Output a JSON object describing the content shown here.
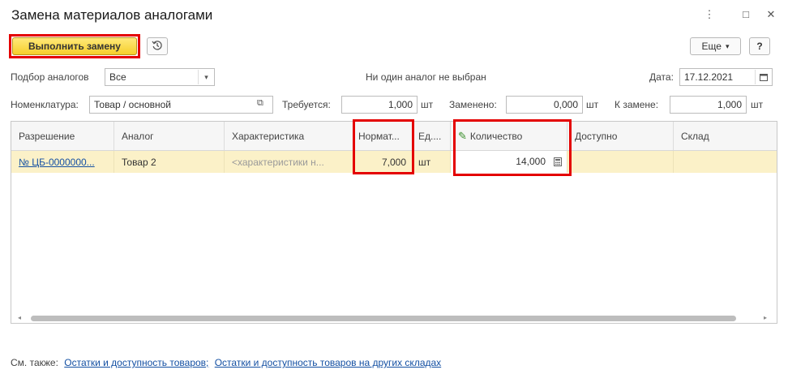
{
  "window": {
    "title": "Замена материалов аналогами",
    "menu_icon": "⋮",
    "maximize_icon": "□",
    "close_icon": "✕"
  },
  "toolbar": {
    "execute_label": "Выполнить замену",
    "history_icon": "history-icon",
    "more_label": "Еще",
    "more_arrow": "▾",
    "help_label": "?"
  },
  "filters": {
    "analog_selection_label": "Подбор аналогов",
    "analog_selection_value": "Все",
    "status_text": "Ни один аналог не выбран",
    "date_label": "Дата:",
    "date_value": "17.12.2021"
  },
  "summary": {
    "nomenclature_label": "Номенклатура:",
    "nomenclature_value": "Товар / основной",
    "required_label": "Требуется:",
    "required_value": "1,000",
    "required_unit": "шт",
    "replaced_label": "Заменено:",
    "replaced_value": "0,000",
    "replaced_unit": "шт",
    "to_replace_label": "К замене:",
    "to_replace_value": "1,000",
    "to_replace_unit": "шт"
  },
  "table": {
    "columns": [
      "Разрешение",
      "Аналог",
      "Характеристика",
      "Нормат...",
      "Ед....",
      "Количество",
      "Доступно",
      "Склад"
    ],
    "rows": [
      {
        "permission": "№ ЦБ-0000000...",
        "analog": "Товар 2",
        "characteristic": "<характеристики н...",
        "norm": "7,000",
        "unit": "шт",
        "quantity": "14,000",
        "available": "",
        "warehouse": ""
      }
    ]
  },
  "footer": {
    "see_also_label": "См. также:",
    "link1": "Остатки и доступность товаров;",
    "link2": "Остатки и доступность товаров на других складах"
  },
  "colors": {
    "highlight": "#e40000",
    "primary_button": "#f6cf2a",
    "selected_row": "#fbf1c8",
    "link": "#1450a3"
  }
}
